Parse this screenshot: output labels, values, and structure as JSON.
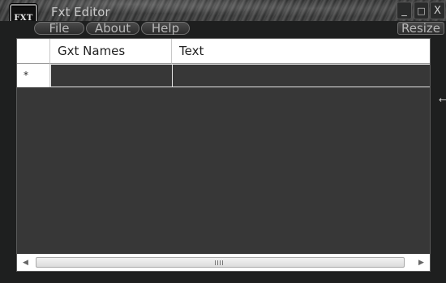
{
  "window": {
    "title": "Fxt Editor",
    "logo_text": "FXT",
    "controls": {
      "minimize": "_",
      "maximize": "□",
      "close": "X"
    }
  },
  "menu": {
    "items": [
      {
        "label": "File"
      },
      {
        "label": "About"
      },
      {
        "label": "Help"
      }
    ],
    "resize_label": "Resize"
  },
  "grid": {
    "columns": [
      "Gxt Names",
      "Text"
    ],
    "new_row_marker": "*",
    "rows": [
      {
        "gxt_name": "",
        "text": ""
      }
    ]
  },
  "scrollbar": {
    "left_arrow": "◀",
    "right_arrow": "▶"
  },
  "resize_handle": "⟷"
}
